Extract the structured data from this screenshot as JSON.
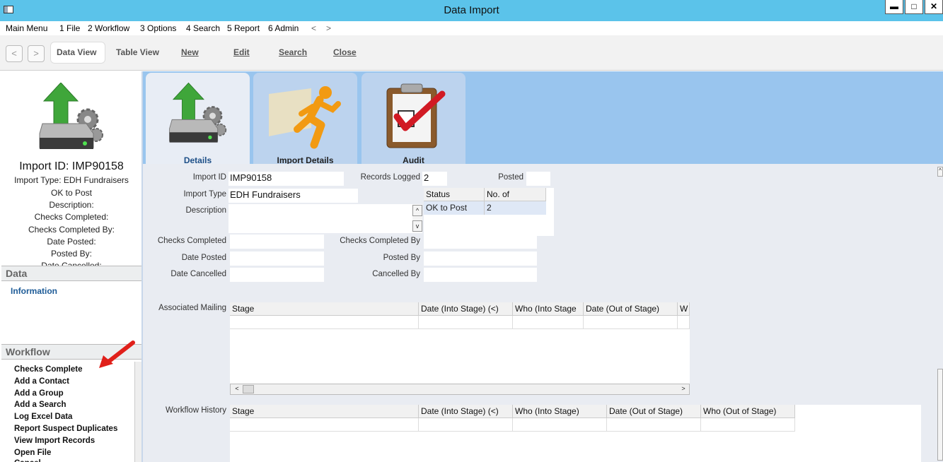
{
  "window": {
    "title": "Data Import",
    "min_label": "▬",
    "max_label": "□",
    "close_label": "✕"
  },
  "menu": {
    "items": [
      "Main Menu",
      "1 File",
      "2 Workflow",
      "3 Options",
      "4 Search",
      "5 Report",
      "6 Admin",
      "<",
      ">"
    ]
  },
  "toolbar": {
    "back": "<",
    "forward": ">",
    "data_view": "Data View",
    "table_view": "Table View",
    "new": "New",
    "edit": "Edit",
    "search": "Search",
    "close": "Close"
  },
  "sidebar": {
    "import_id": "Import ID: IMP90158",
    "lines": [
      "Import Type: EDH Fundraisers",
      "OK to Post",
      "Description:",
      "Checks Completed:",
      "Checks Completed By:",
      "Date Posted:",
      "Posted By:",
      "Date Cancelled:"
    ],
    "data_section": "Data",
    "info_link": "Information",
    "workflow_section": "Workflow",
    "workflow_items": [
      "Checks Complete",
      "Add a Contact",
      "Add a Group",
      "Add a Search",
      "Log Excel Data",
      "Report Suspect Duplicates",
      "View Import Records",
      "Open File",
      "Cancel"
    ]
  },
  "tabs": [
    {
      "label": "Details"
    },
    {
      "label": "Import Details"
    },
    {
      "label": "Audit"
    }
  ],
  "form": {
    "import_id_label": "Import ID",
    "import_id": "IMP90158",
    "records_logged_label": "Records Logged",
    "records_logged": "2",
    "posted_label": "Posted",
    "posted": "",
    "import_type_label": "Import Type",
    "import_type": "EDH Fundraisers",
    "description_label": "Description",
    "description": "",
    "checks_completed_label": "Checks Completed",
    "checks_completed": "",
    "checks_completed_by_label": "Checks Completed By",
    "checks_completed_by": "",
    "date_posted_label": "Date Posted",
    "date_posted": "",
    "posted_by_label": "Posted By",
    "posted_by": "",
    "date_cancelled_label": "Date Cancelled",
    "date_cancelled": "",
    "cancelled_by_label": "Cancelled By",
    "cancelled_by": ""
  },
  "status_grid": {
    "headers": [
      "Status",
      "No. of"
    ],
    "rows": [
      [
        "OK to Post",
        "2"
      ]
    ]
  },
  "mailing": {
    "label": "Associated Mailing",
    "headers": [
      "Stage",
      "Date (Into Stage) (<)",
      "Who (Into Stage",
      "Date (Out of Stage)",
      "W"
    ]
  },
  "history": {
    "label": "Workflow History",
    "headers": [
      "Stage",
      "Date (Into Stage) (<)",
      "Who (Into Stage)",
      "Date (Out of Stage)",
      "Who (Out of Stage)"
    ]
  },
  "colors": {
    "titlebar": "#5bc3ea",
    "tab_band": "#99c5ee",
    "content_bg": "#e9ecf2",
    "link": "#1d5b97"
  }
}
